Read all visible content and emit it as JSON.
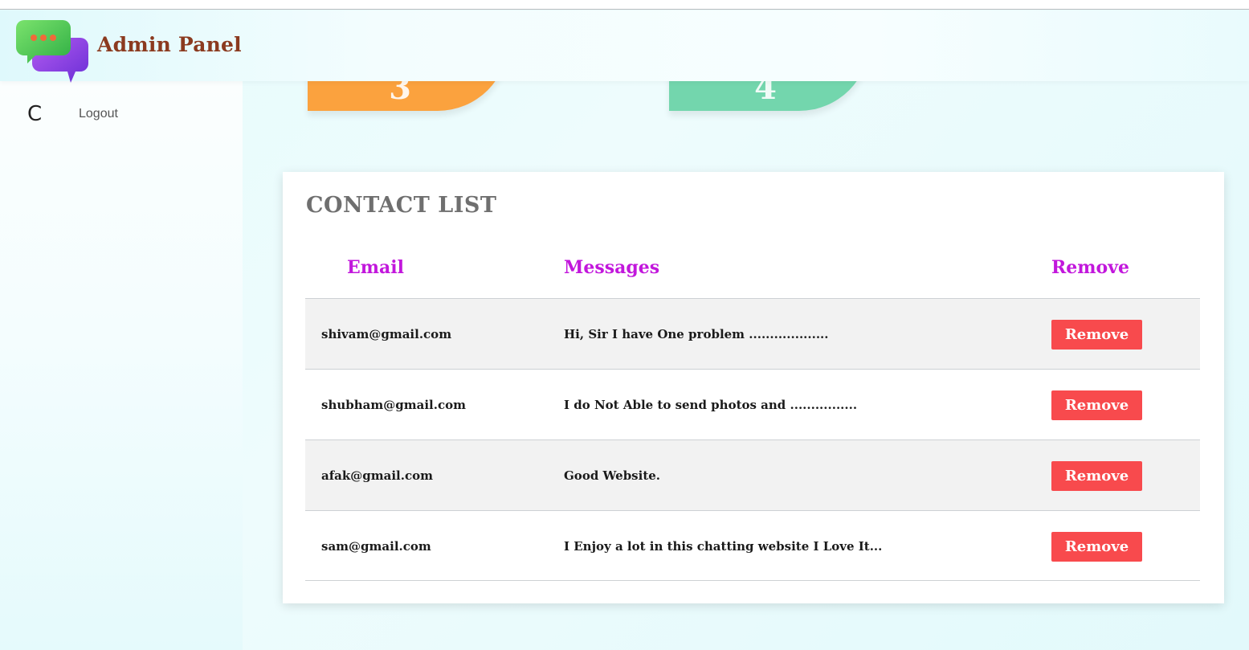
{
  "header": {
    "brand": "Admin Panel"
  },
  "sidebar": {
    "logout_label": "Logout"
  },
  "stats": [
    {
      "value": "3",
      "color": "#fba23e"
    },
    {
      "value": "4",
      "color": "#73d6ad"
    }
  ],
  "contacts": {
    "title": "CONTACT LIST",
    "columns": {
      "email": "Email",
      "messages": "Messages",
      "remove": "Remove"
    },
    "rows": [
      {
        "email": "shivam@gmail.com",
        "message": "Hi, Sir I have One problem ...................",
        "action": "Remove"
      },
      {
        "email": "shubham@gmail.com",
        "message": "I do Not Able to send photos and ................",
        "action": "Remove"
      },
      {
        "email": "afak@gmail.com",
        "message": "Good Website.",
        "action": "Remove"
      },
      {
        "email": "sam@gmail.com",
        "message": "I Enjoy a lot in this chatting website I Love It...",
        "action": "Remove"
      }
    ]
  },
  "colors": {
    "brand": "#8b3a1f",
    "column_header": "#c217dc",
    "remove_button": "#f84a4d"
  }
}
